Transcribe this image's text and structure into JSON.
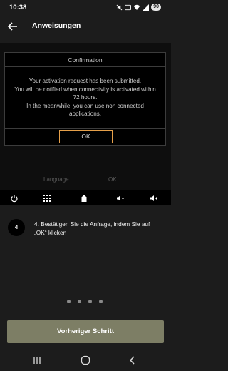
{
  "status_bar": {
    "time": "10:38",
    "battery": "90"
  },
  "app_bar": {
    "title": "Anweisungen"
  },
  "dialog": {
    "title": "Confirmation",
    "lines": [
      "Your activation request has been submitted.",
      "You will be notified when connectivity is activated within",
      "72 hours.",
      "In the meanwhile, you can use non connected",
      "applications."
    ],
    "ok_label": "OK"
  },
  "dimmed_strip": {
    "language_label": "Language",
    "ok_label": "OK"
  },
  "control_bar": {
    "icons": [
      "power-icon",
      "grid-icon",
      "home-icon",
      "volume-down-icon",
      "volume-up-icon"
    ]
  },
  "step": {
    "number": "4",
    "text": "4. Bestätigen Sie die Anfrage, indem Sie auf „OK“ klicken"
  },
  "pagination": {
    "count": 4
  },
  "previous_button": {
    "label": "Vorheriger Schritt"
  },
  "colors": {
    "background": "#1c1c1c",
    "accent_button": "#7d7e65",
    "ok_border": "#e6a04a"
  }
}
